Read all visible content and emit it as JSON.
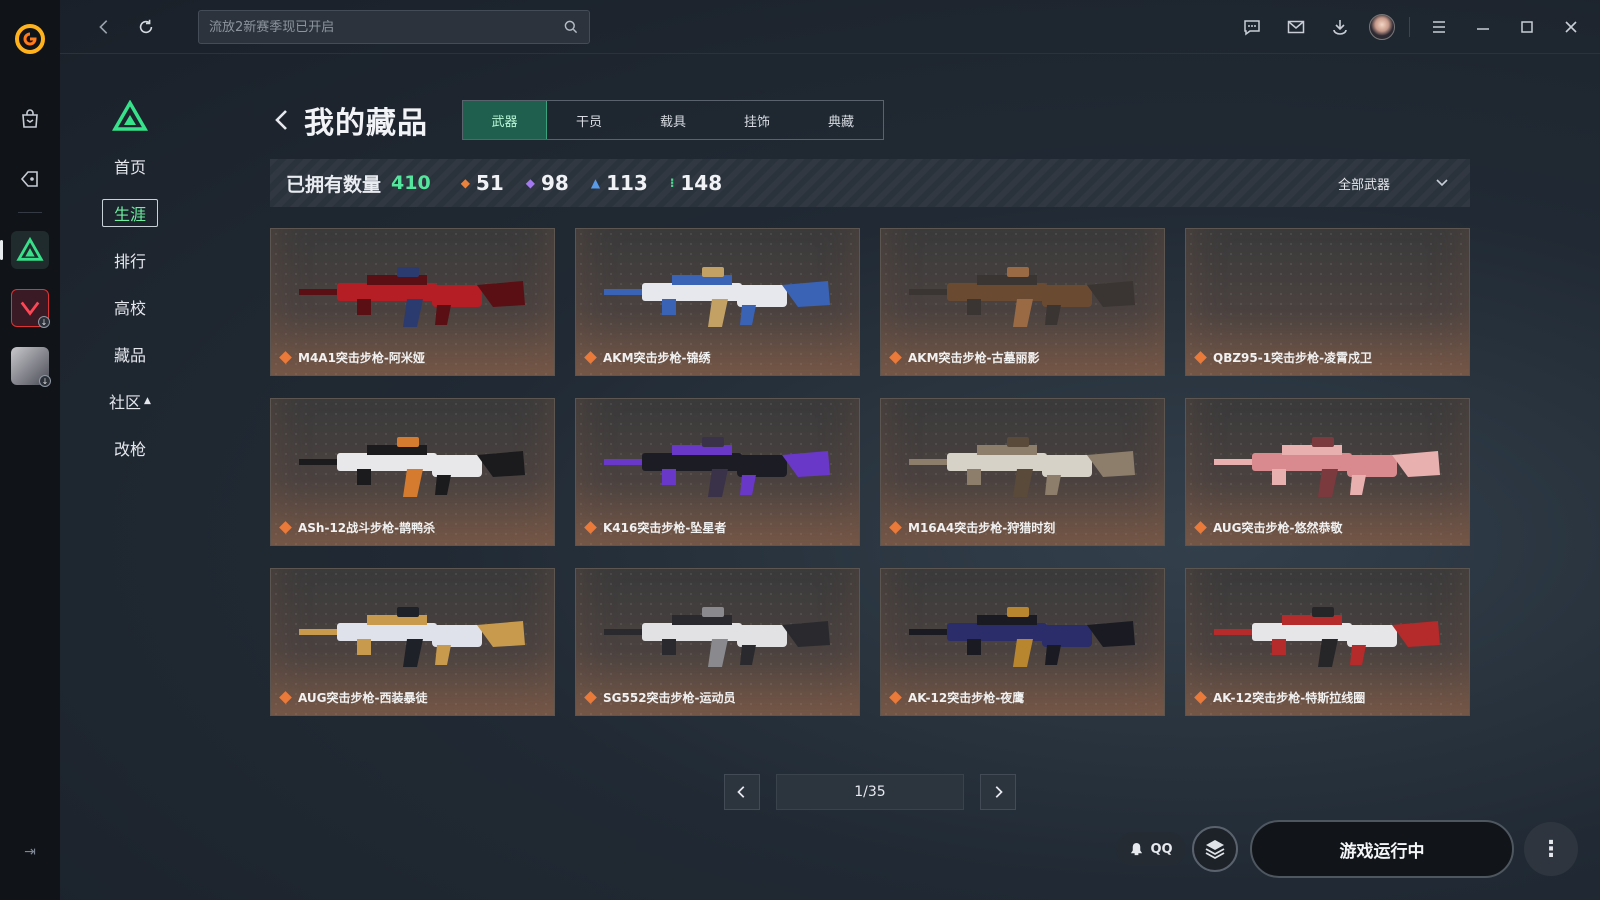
{
  "search": {
    "placeholder": "流放2新赛季现已开启"
  },
  "subnav": {
    "items": [
      {
        "label": "首页",
        "active": false
      },
      {
        "label": "生涯",
        "active": true
      },
      {
        "label": "排行",
        "active": false
      },
      {
        "label": "高校",
        "active": false
      },
      {
        "label": "藏品",
        "active": false
      },
      {
        "label": "社区",
        "active": false
      },
      {
        "label": "改枪",
        "active": false
      }
    ]
  },
  "header": {
    "title": "我的藏品",
    "tabs": [
      "武器",
      "干员",
      "载具",
      "挂饰",
      "典藏"
    ],
    "active_tab": "武器"
  },
  "stats": {
    "label": "已拥有数量",
    "total": "410",
    "counts": [
      {
        "value": "51",
        "color": "#e9823d"
      },
      {
        "value": "98",
        "color": "#a478f0"
      },
      {
        "value": "113",
        "color": "#5a9be8"
      },
      {
        "value": "148",
        "color": "#4fd690"
      }
    ],
    "filter": "全部武器"
  },
  "items": [
    {
      "name": "M4A1突击步枪-阿米娅",
      "colors": [
        "#b41e24",
        "#5a0f14",
        "#2b3b70"
      ]
    },
    {
      "name": "AKM突击步枪-锦绣",
      "colors": [
        "#e6e8ee",
        "#3a63b5",
        "#c3a064"
      ]
    },
    {
      "name": "AKM突击步枪-古墓丽影",
      "colors": [
        "#6b4a32",
        "#3a3432",
        "#9a6a45"
      ]
    },
    {
      "name": "QBZ95-1突击步枪-凌霄戍卫",
      "colors": []
    },
    {
      "name": "ASh-12战斗步枪-鹊鸭杀",
      "colors": [
        "#e8e8ea",
        "#1b1b1d",
        "#d47b2f"
      ]
    },
    {
      "name": "K416突击步枪-坠星者",
      "colors": [
        "#1c1c24",
        "#6a38c8",
        "#3a3248"
      ]
    },
    {
      "name": "M16A4突击步枪-狩猎时刻",
      "colors": [
        "#d6d2c8",
        "#8c7e6a",
        "#5a4a3a"
      ]
    },
    {
      "name": "AUG突击步枪-悠然恭敬",
      "colors": [
        "#d88a8e",
        "#e9b0b0",
        "#7a3a3e"
      ]
    },
    {
      "name": "AUG突击步枪-西装暴徒",
      "colors": [
        "#dfe2ea",
        "#c79a4e",
        "#1f2128"
      ]
    },
    {
      "name": "SG552突击步枪-运动员",
      "colors": [
        "#e2e2e4",
        "#2a2a2e",
        "#8a8a8e"
      ]
    },
    {
      "name": "AK-12突击步枪-夜鹰",
      "colors": [
        "#2a2d6a",
        "#1a1a22",
        "#b8862f"
      ]
    },
    {
      "name": "AK-12突击步枪-特斯拉线圈",
      "colors": [
        "#e6e6e8",
        "#b52a2a",
        "#262628"
      ]
    }
  ],
  "pager": {
    "label": "1/35"
  },
  "bottom": {
    "qq_label": "QQ",
    "launch_label": "游戏运行中"
  }
}
